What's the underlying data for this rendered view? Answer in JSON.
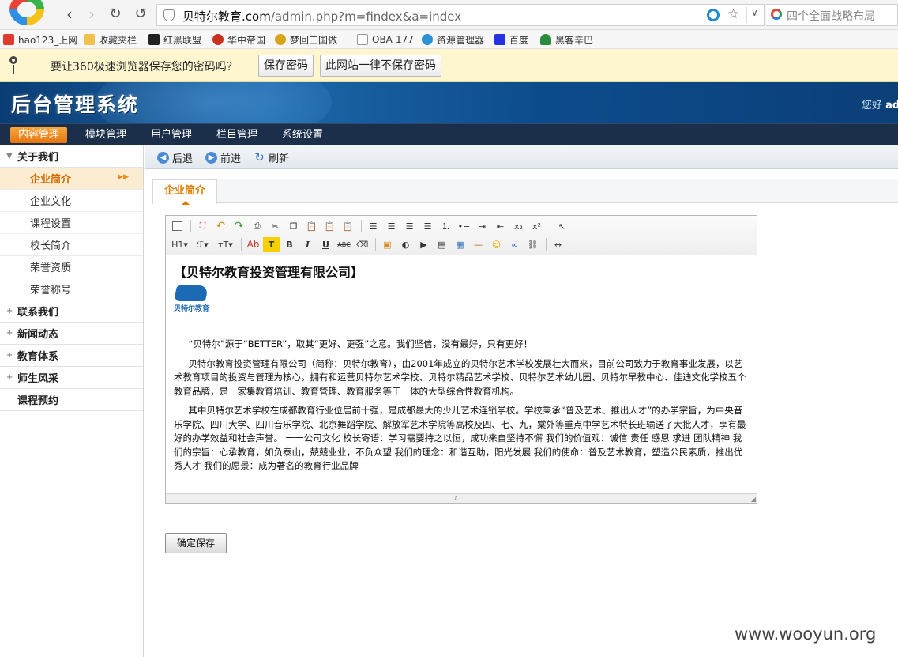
{
  "browser": {
    "url_host": "贝特尔教育.com",
    "url_path": "/admin.php?m=findex&a=index",
    "search_placeholder": "四个全面战略布局",
    "favorites": [
      {
        "label": "hao123_上网",
        "color": "#e23a2e"
      },
      {
        "label": "收藏夹栏",
        "color": "#f3c14b"
      },
      {
        "label": "红黑联盟",
        "color": "#222222"
      },
      {
        "label": "华中帝国",
        "color": "#c8331f"
      },
      {
        "label": "梦回三国做",
        "color": "#d9a31a"
      },
      {
        "label": "OBA-177",
        "color": "#ffffff"
      },
      {
        "label": "资源管理器",
        "color": "#2d8fd6"
      },
      {
        "label": "百度",
        "color": "#2932e1"
      },
      {
        "label": "黑客辛巴",
        "color": "#2b8a3e"
      }
    ],
    "password_bar": {
      "message": "要让360极速浏览器保存您的密码吗？",
      "save_label": "保存密码",
      "never_label": "此网站一律不保存密码"
    }
  },
  "header": {
    "title": "后台管理系统",
    "greeting": "您好",
    "username": "adm"
  },
  "top_menu": [
    {
      "label": "内容管理",
      "active": true
    },
    {
      "label": "模块管理"
    },
    {
      "label": "用户管理"
    },
    {
      "label": "栏目管理"
    },
    {
      "label": "系统设置"
    }
  ],
  "sidebar": {
    "groups": [
      {
        "label": "关于我们",
        "expanded": true,
        "items": [
          "企业简介",
          "企业文化",
          "课程设置",
          "校长简介",
          "荣誉资质",
          "荣誉称号"
        ]
      },
      {
        "label": "联系我们"
      },
      {
        "label": "新闻动态"
      },
      {
        "label": "教育体系"
      },
      {
        "label": "师生风采"
      },
      {
        "label": "课程预约"
      }
    ]
  },
  "toolbar": {
    "back": "后退",
    "forward": "前进",
    "refresh": "刷新"
  },
  "tab": {
    "label": "企业简介"
  },
  "editor": {
    "heading": "【贝特尔教育投资管理有限公司】",
    "logo_text": "贝特尔教育",
    "paragraphs": [
      "“贝特尔”源于“BETTER”，取其“更好、更强”之意。我们坚信，没有最好，只有更好！",
      "贝特尔教育投资管理有限公司（简称：贝特尔教育），由2001年成立的贝特尔艺术学校发展壮大而来，目前公司致力于教育事业发展，以艺术教育项目的投资与管理为核心，拥有和运营贝特尔艺术学校、贝特尔精品艺术学校、贝特尔艺术幼儿园、贝特尔早教中心、佳迪文化学校五个教育品牌，是一家集教育培训、教育管理、教育服务等于一体的大型综合性教育机构。",
      "其中贝特尔艺术学校在成都教育行业位居前十强，是成都最大的少儿艺术连锁学校。学校秉承“普及艺术、推出人才”的办学宗旨，为中央音乐学院、四川大学、四川音乐学院、北京舞蹈学院、解放军艺术学院等高校及四、七、九，棠外等重点中学艺术特长班输送了大批人才，享有最好的办学效益和社会声誉。 一一公司文化 校长寄语：学习需要持之以恒，成功来自坚持不懈 我们的价值观：诚信 责任 感恩 求进 团队精神 我们的宗旨：心承教育，如负泰山，兢兢业业，不负众望 我们的理念：和谐互助，阳光发展 我们的使命：普及艺术教育，塑造公民素质，推出优秀人才 我们的愿景：成为著名的教育行业品牌"
    ],
    "tools_row2": {
      "heading": "H1",
      "font": "ℱ",
      "size": "тT",
      "forecolor": "Ab",
      "bold": "B",
      "italic": "I",
      "underline": "U",
      "strike": "ABC"
    }
  },
  "save_button": "确定保存",
  "watermark": "www.wooyun.org"
}
